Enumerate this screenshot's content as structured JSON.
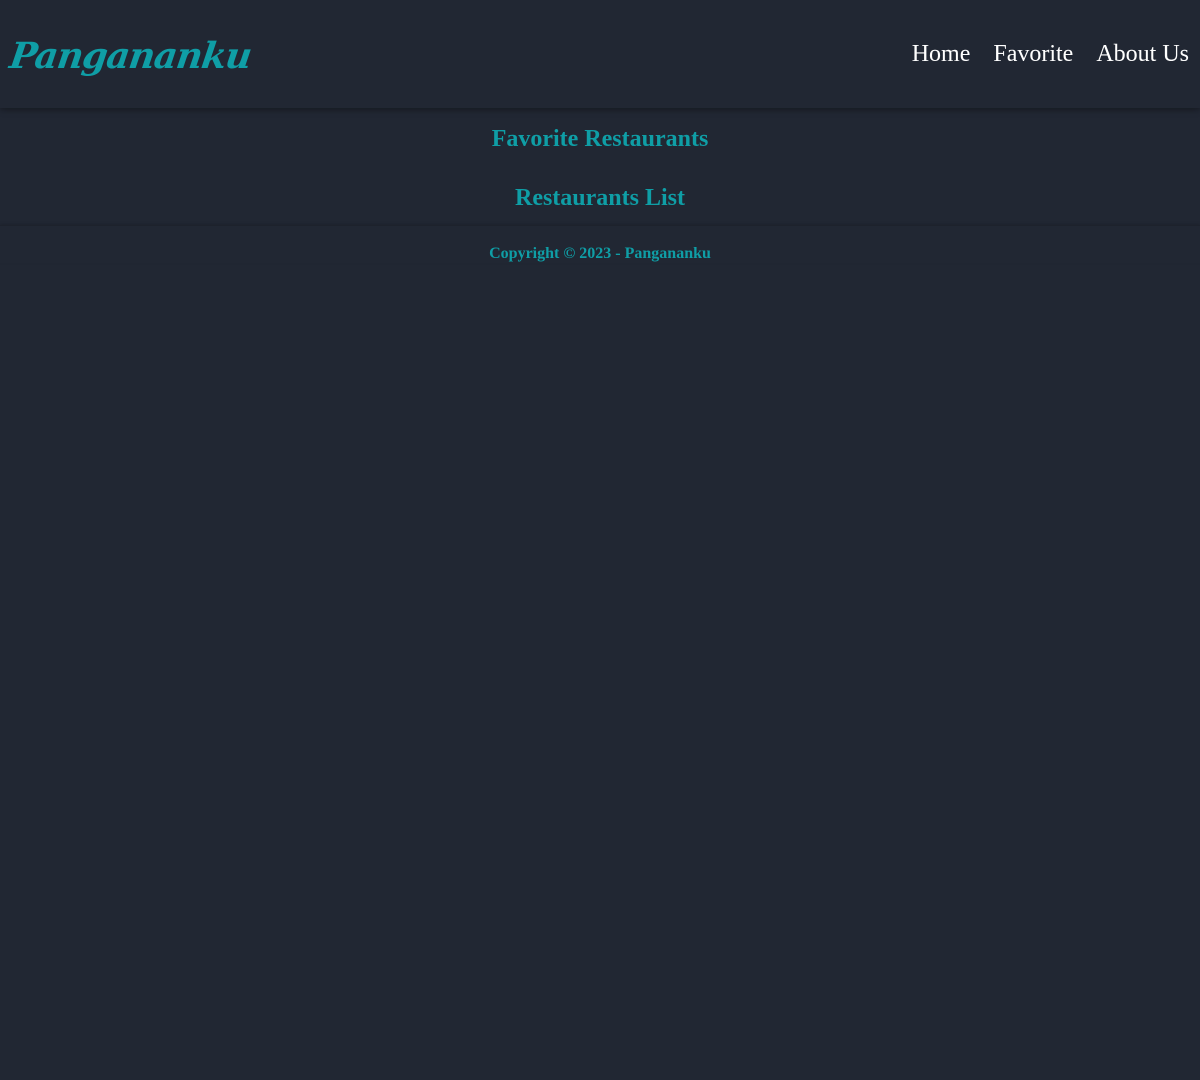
{
  "header": {
    "brand": "Panganan­ku",
    "nav": [
      {
        "label": "Home"
      },
      {
        "label": "Favorite"
      },
      {
        "label": "About Us"
      }
    ]
  },
  "main": {
    "favorite_title": "Favorite Restaurants",
    "list_title": "Restaurants List"
  },
  "footer": {
    "copyright": "Copyright © 2023 - Pangananku"
  },
  "colors": {
    "background": "#212733",
    "accent": "#0f9ea6",
    "nav_text": "#ffffff"
  }
}
